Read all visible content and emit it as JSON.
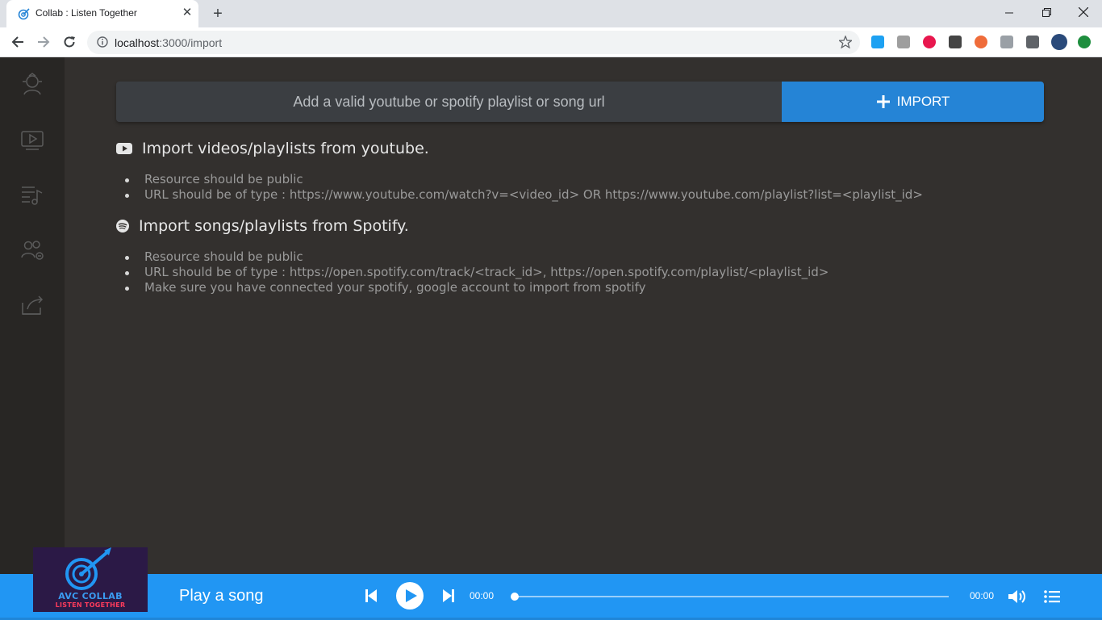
{
  "browser": {
    "tab_title": "Collab : Listen Together",
    "url_host": "localhost",
    "url_path": ":3000/import",
    "window_controls": [
      "minimize-icon",
      "restore-icon",
      "close-icon"
    ]
  },
  "import": {
    "placeholder": "Add a valid youtube or spotify playlist or song url",
    "button_label": "IMPORT"
  },
  "sections": {
    "youtube": {
      "title": "Import videos/playlists from youtube.",
      "items": [
        "Resource should be public",
        "URL should be of type : https://www.youtube.com/watch?v=<video_id> OR https://www.youtube.com/playlist?list=<playlist_id>"
      ]
    },
    "spotify": {
      "title": "Import songs/playlists from Spotify.",
      "items": [
        "Resource should be public",
        "URL should be of type : https://open.spotify.com/track/<track_id>, https://open.spotify.com/playlist/<playlist_id>",
        "Make sure you have connected your spotify, google account to import from spotify"
      ]
    }
  },
  "sidebar": {
    "icons": [
      "profile-icon",
      "video-icon",
      "playlist-icon",
      "users-icon",
      "import-icon"
    ]
  },
  "player": {
    "logo_line1": "AVC COLLAB",
    "logo_line2": "LISTEN TOGETHER",
    "song_title": "Play a song",
    "current_time": "00:00",
    "total_time": "00:00",
    "progress": 0
  },
  "colors": {
    "accent": "#2196f3",
    "import_button": "#2584d6",
    "background": "#33302e",
    "sidebar": "#282624"
  }
}
